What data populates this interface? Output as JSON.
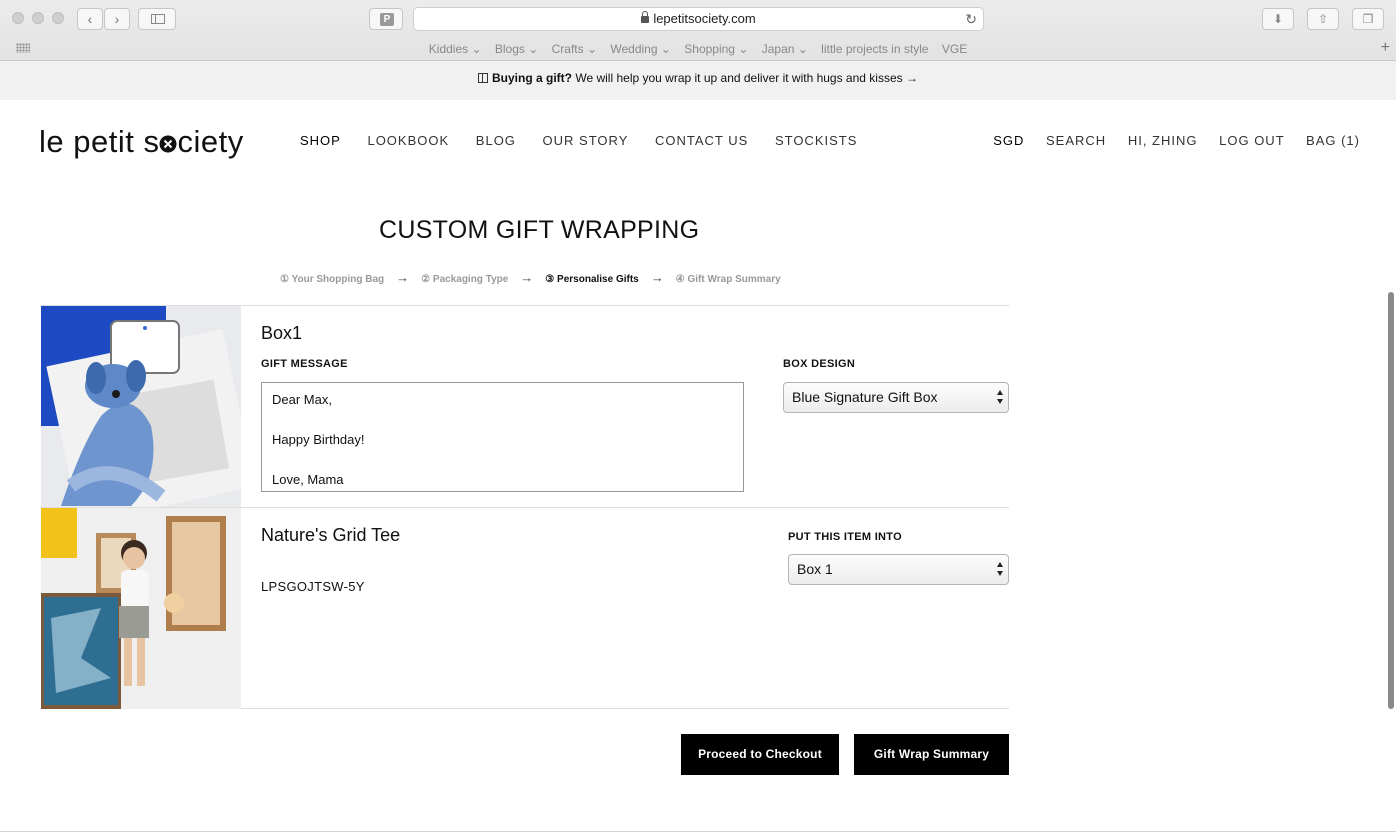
{
  "browser": {
    "url": "lepetitsociety.com",
    "bookmarks": [
      "Kiddies ⌄",
      "Blogs ⌄",
      "Crafts ⌄",
      "Wedding ⌄",
      "Shopping ⌄",
      "Japan ⌄",
      "little projects in style",
      "VGE"
    ]
  },
  "promo": {
    "bold": "Buying a gift?",
    "text": " We will help you wrap it up and deliver it with hugs and kisses →"
  },
  "header": {
    "logo_left": "le petit s",
    "logo_right": "ciety",
    "nav": [
      "SHOP",
      "LOOKBOOK",
      "BLOG",
      "OUR STORY",
      "CONTACT US",
      "STOCKISTS"
    ],
    "user": [
      "SGD",
      "SEARCH",
      "HI, ZHING",
      "LOG OUT",
      "BAG (1)"
    ]
  },
  "page": {
    "title": "CUSTOM GIFT WRAPPING",
    "steps": [
      "① Your Shopping Bag",
      "② Packaging Type",
      "③ Personalise Gifts",
      "④ Gift Wrap Summary"
    ],
    "active_step": 2
  },
  "box": {
    "title": "Box1",
    "gift_message_label": "GIFT MESSAGE",
    "gift_message": "Dear Max,\n\nHappy Birthday!\n\nLove, Mama",
    "box_design_label": "BOX DESIGN",
    "box_design_value": "Blue Signature Gift Box"
  },
  "item": {
    "title": "Nature's Grid Tee",
    "sku": "LPSGOJTSW-5Y",
    "put_into_label": "PUT THIS ITEM INTO",
    "put_into_value": "Box 1"
  },
  "actions": {
    "checkout": "Proceed to Checkout",
    "summary": "Gift Wrap Summary"
  }
}
